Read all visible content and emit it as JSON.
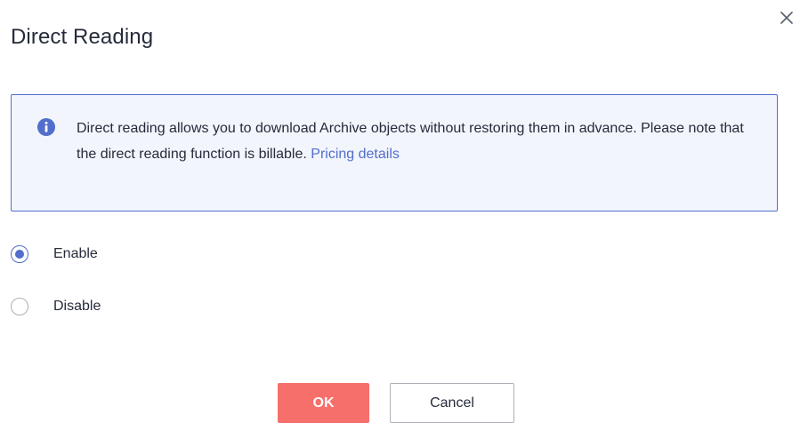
{
  "dialog": {
    "title": "Direct Reading",
    "close_icon": "close-icon"
  },
  "notice": {
    "icon": "info-icon",
    "text_before_link": "Direct reading allows you to download Archive objects without restoring them in advance. Please note that the direct reading function is billable. ",
    "link_text": "Pricing details"
  },
  "options": {
    "selected": "Enable",
    "items": [
      {
        "label": "Enable",
        "checked": true
      },
      {
        "label": "Disable",
        "checked": false
      }
    ]
  },
  "buttons": {
    "ok_label": "OK",
    "cancel_label": "Cancel"
  },
  "colors": {
    "accent": "#526ecc",
    "primary_button": "#f66f6a",
    "notice_background": "#f2f5fc"
  }
}
